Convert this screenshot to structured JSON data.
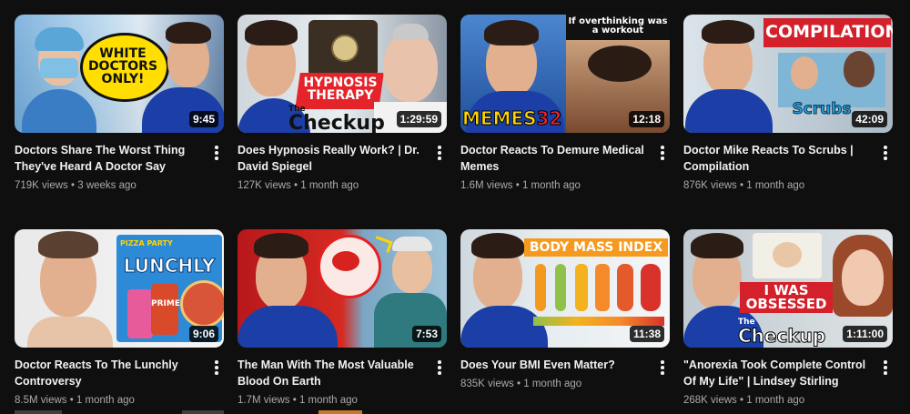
{
  "videos": [
    {
      "title": "Doctors Share The Worst Thing They've Heard A Doctor Say",
      "views": "719K views",
      "age": "3 weeks ago",
      "duration": "9:45",
      "thumb_text": "WHITE DOCTORS ONLY!"
    },
    {
      "title": "Does Hypnosis Really Work? | Dr. David Spiegel",
      "views": "127K views",
      "age": "1 month ago",
      "duration": "1:29:59",
      "thumb_text": "HYPNOSIS THERAPY",
      "thumb_brand_the": "The",
      "thumb_brand": "Checkup"
    },
    {
      "title": "Doctor Reacts To Demure Medical Memes",
      "views": "1.6M views",
      "age": "1 month ago",
      "duration": "12:18",
      "thumb_text": "If overthinking was a workout",
      "thumb_memes": "MEMES",
      "thumb_num": "32"
    },
    {
      "title": "Doctor Mike Reacts To Scrubs | Compilation",
      "views": "876K views",
      "age": "1 month ago",
      "duration": "42:09",
      "thumb_text": "COMPILATION",
      "thumb_logo": "Scrubs"
    },
    {
      "title": "Doctor Reacts To The Lunchly Controversy",
      "views": "8.5M views",
      "age": "1 month ago",
      "duration": "9:06",
      "thumb_text": "LUNCHLY",
      "thumb_small": "PIZZA PARTY",
      "thumb_can": "PRIME"
    },
    {
      "title": "The Man With The Most Valuable Blood On Earth",
      "views": "1.7M views",
      "age": "1 month ago",
      "duration": "7:53"
    },
    {
      "title": "Does Your BMI Even Matter?",
      "views": "835K views",
      "age": "1 month ago",
      "duration": "11:38",
      "thumb_text": "BODY MASS INDEX"
    },
    {
      "title": "\"Anorexia Took Complete Control Of My Life\" | Lindsey Stirling",
      "views": "268K views",
      "age": "1 month ago",
      "duration": "1:11:00",
      "thumb_text": "I WAS OBSESSED",
      "thumb_brand_the": "The",
      "thumb_brand": "Checkup"
    }
  ],
  "separator": "•",
  "colors": {
    "background": "#0f0f0f",
    "title": "#f1f1f1",
    "meta": "#aaaaaa",
    "hypnosis_red": "#e4242a",
    "memes_yellow": "#ffd400",
    "compilation_red": "#d4202a"
  },
  "icons": [
    "more-vert-icon"
  ]
}
